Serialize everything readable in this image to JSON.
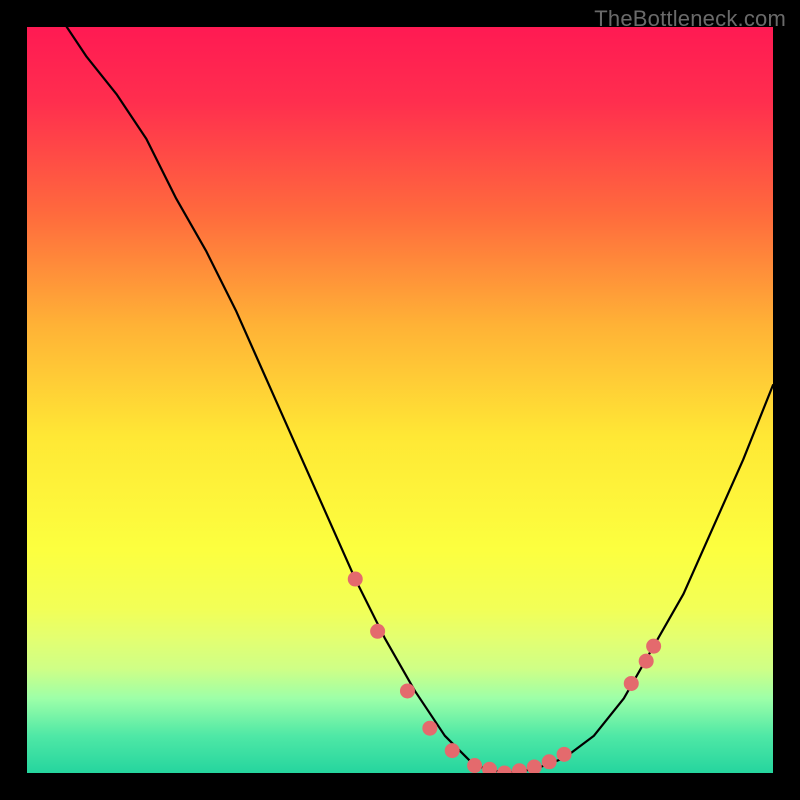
{
  "watermark": "TheBottleneck.com",
  "chart_data": {
    "type": "line",
    "title": "",
    "xlabel": "",
    "ylabel": "",
    "xlim": [
      0,
      100
    ],
    "ylim": [
      0,
      100
    ],
    "grid": false,
    "legend": null,
    "background_gradient": {
      "stops": [
        {
          "offset": 0,
          "color": "#ff1a53"
        },
        {
          "offset": 10,
          "color": "#ff2e4e"
        },
        {
          "offset": 25,
          "color": "#ff6a3d"
        },
        {
          "offset": 40,
          "color": "#ffb236"
        },
        {
          "offset": 55,
          "color": "#ffe835"
        },
        {
          "offset": 70,
          "color": "#fcff3f"
        },
        {
          "offset": 78,
          "color": "#f2ff57"
        },
        {
          "offset": 82,
          "color": "#e3ff71"
        },
        {
          "offset": 86,
          "color": "#cfff86"
        },
        {
          "offset": 90,
          "color": "#9dffa8"
        },
        {
          "offset": 95,
          "color": "#4fe8a6"
        },
        {
          "offset": 100,
          "color": "#25d59e"
        }
      ]
    },
    "series": [
      {
        "name": "bottleneck-curve",
        "x": [
          0,
          4,
          8,
          12,
          16,
          20,
          24,
          28,
          32,
          36,
          40,
          44,
          48,
          52,
          56,
          60,
          64,
          68,
          72,
          76,
          80,
          84,
          88,
          92,
          96,
          100
        ],
        "y": [
          108,
          102,
          96,
          91,
          85,
          77,
          70,
          62,
          53,
          44,
          35,
          26,
          18,
          11,
          5,
          1,
          0,
          0.5,
          2,
          5,
          10,
          17,
          24,
          33,
          42,
          52
        ]
      }
    ],
    "points": {
      "name": "marked-points",
      "x": [
        44,
        47,
        51,
        54,
        57,
        60,
        62,
        64,
        66,
        68,
        70,
        72,
        81,
        83,
        84
      ],
      "y": [
        26,
        19,
        11,
        6,
        3,
        1,
        0.5,
        0,
        0.3,
        0.8,
        1.5,
        2.5,
        12,
        15,
        17
      ]
    }
  }
}
